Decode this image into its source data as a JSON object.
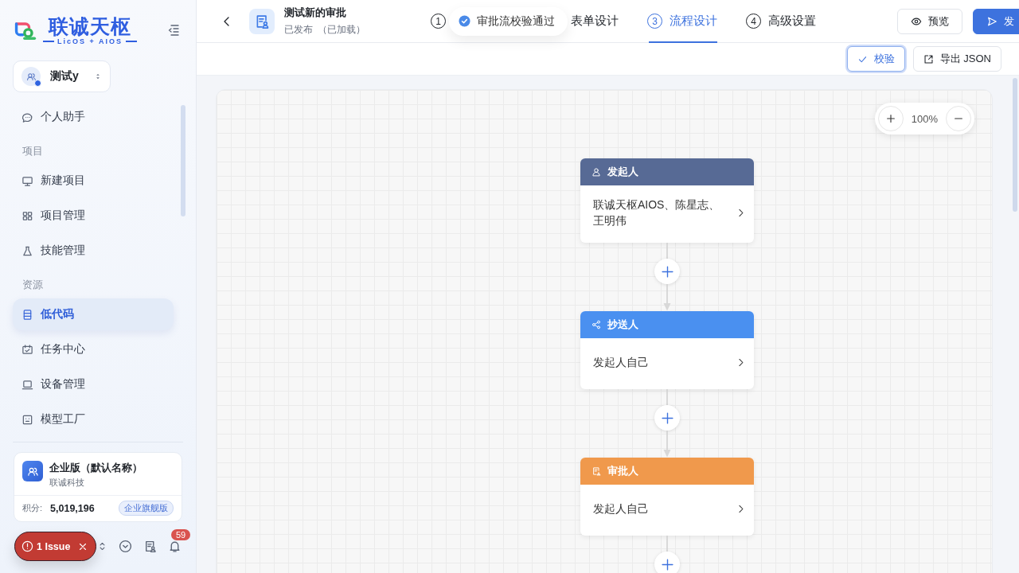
{
  "sidebar": {
    "logo": {
      "title": "联诚天枢",
      "subtitle": "LicOS + AIOS"
    },
    "workspace": "测试y",
    "nav": [
      {
        "kind": "item",
        "label": "个人助手",
        "selected": false
      },
      {
        "kind": "section",
        "label": "项目"
      },
      {
        "kind": "item",
        "label": "新建项目",
        "selected": false
      },
      {
        "kind": "item",
        "label": "项目管理",
        "selected": false
      },
      {
        "kind": "item",
        "label": "技能管理",
        "selected": false
      },
      {
        "kind": "section",
        "label": "资源"
      },
      {
        "kind": "item",
        "label": "低代码",
        "selected": true
      },
      {
        "kind": "item",
        "label": "任务中心",
        "selected": false
      },
      {
        "kind": "item",
        "label": "设备管理",
        "selected": false
      },
      {
        "kind": "item",
        "label": "模型工厂",
        "selected": false
      }
    ],
    "org": {
      "name": "企业版（默认名称）",
      "company": "联诚科技",
      "points_label": "积分:",
      "points": "5,019,196",
      "plan": "企业旗舰版"
    },
    "issue_badge": "1 Issue",
    "notification_count": "59"
  },
  "header": {
    "title": "测试新的审批",
    "status": "已发布",
    "loaded": "（已加载）",
    "steps": [
      {
        "number": "1",
        "selected": false
      },
      {
        "label": "表单设计",
        "selected": false
      },
      {
        "number": "3",
        "label": "流程设计",
        "selected": true
      },
      {
        "number": "4",
        "label": "高级设置",
        "selected": false
      }
    ],
    "buttons": [
      {
        "kind": "outline",
        "label": "预览"
      },
      {
        "kind": "primary",
        "label": "发"
      }
    ]
  },
  "toast": "审批流校验通过",
  "toolbar": [
    {
      "kind": "validate",
      "label": "校验"
    },
    {
      "kind": "export",
      "label": "导出 JSON"
    }
  ],
  "canvas": {
    "zoom": "100%",
    "nodes": [
      {
        "kind": "initiator",
        "title": "发起人",
        "color": "#576a95",
        "content": "联诚天枢AIOS、陈星志、王明伟"
      },
      {
        "kind": "cc",
        "title": "抄送人",
        "color": "#4a90f0",
        "content": "发起人自己"
      },
      {
        "kind": "approver",
        "title": "审批人",
        "color": "#f0994c",
        "content": "发起人自己"
      }
    ]
  }
}
